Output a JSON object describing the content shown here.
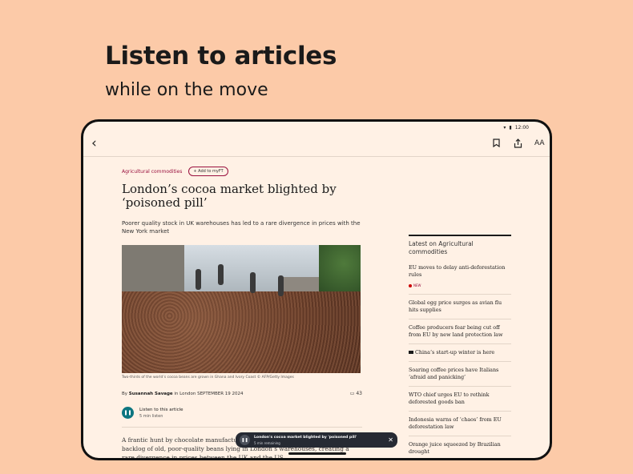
{
  "promo": {
    "title": "Listen to articles",
    "subtitle": "while on the move"
  },
  "status_bar": {
    "time": "12:00"
  },
  "toolbar": {
    "back_icon": "chevron-left-icon",
    "icons": [
      "bookmark-icon",
      "share-icon",
      "text-size-icon"
    ],
    "text_size_label": "AA"
  },
  "article": {
    "topic": "Agricultural commodities",
    "add_to_myft": "+ Add to myFT",
    "headline": "London’s cocoa market blighted by ‘poisoned pill’",
    "standfirst": "Poorer quality stock in UK warehouses has led to a rare divergence in prices with the New York market",
    "image_caption": "Two-thirds of the world’s cocoa beans are grown in Ghana and Ivory Coast © AFP/Getty Images",
    "byline_prefix": "By",
    "author": "Susannah Savage",
    "byline_suffix": "in London SEPTEMBER 19 2024",
    "comment_count": "43",
    "listen_title": "Listen to this article",
    "listen_duration": "5 min listen",
    "body": "A frantic hunt by chocolate manufacturers for high-grade cocoa has left a backlog of old, poor-quality beans lying in London’s warehouses, creating a rare divergence in prices between the UK and the US."
  },
  "sidebar": {
    "heading": "Latest on Agricultural commodities",
    "new_label": "NEW",
    "items": [
      "EU moves to delay anti-deforestation rules",
      "Global egg price surges as avian flu hits supplies",
      "Coffee producers fear being cut off from EU by new land protection law",
      "China’s start-up winter is here",
      "Soaring coffee prices have Italians ‘afraid and panicking’",
      "WTO chief urges EU to rethink deforested goods ban",
      "Indonesia warns of ‘chaos’ from EU deforestation law",
      "Orange juice squeezed by Brazilian drought"
    ]
  },
  "player": {
    "title": "London's cocoa market blighted by 'poisoned pill'",
    "remaining": "5 min remaining"
  },
  "colors": {
    "background": "#fccaa8",
    "paper": "#fff1e5",
    "claret": "#990f3d",
    "teal": "#0d7680"
  }
}
